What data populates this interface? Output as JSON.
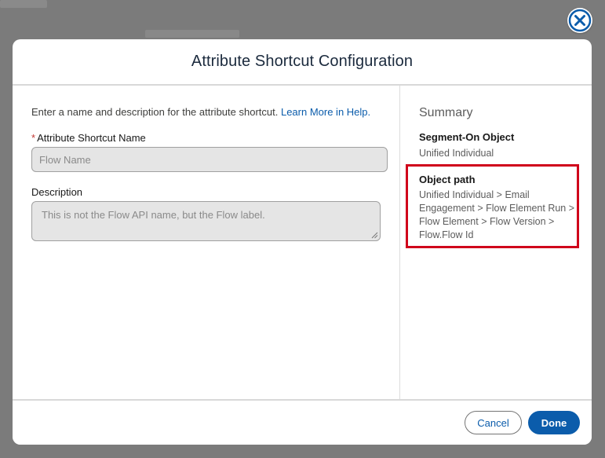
{
  "modal": {
    "title": "Attribute Shortcut Configuration"
  },
  "form": {
    "intro_text": "Enter a name and description for the attribute shortcut. ",
    "intro_link": "Learn More in Help.",
    "name_required_marker": "*",
    "name_label": "Attribute Shortcut Name",
    "name_placeholder": "Flow Name",
    "description_label": "Description",
    "description_placeholder": "This is not the Flow API name, but the Flow label."
  },
  "summary": {
    "title": "Summary",
    "segment_on_label": "Segment-On Object",
    "segment_on_value": "Unified Individual",
    "object_path_label": "Object path",
    "object_path_value": "Unified Individual > Email Engagement > Flow Element Run > Flow Element > Flow Version > Flow.Flow Id"
  },
  "footer": {
    "cancel_label": "Cancel",
    "done_label": "Done"
  },
  "colors": {
    "brand": "#0b5cab",
    "highlight": "#d0021b"
  },
  "icons": {
    "close": "close-icon"
  }
}
